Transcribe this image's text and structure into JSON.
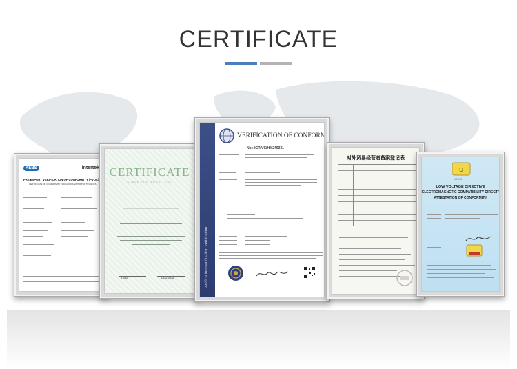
{
  "page": {
    "title": "CERTIFICATE",
    "accent_blue": "#4a7ebd",
    "accent_gray": "#b3b3b3"
  },
  "certificates": [
    {
      "name": "pvoc",
      "heading": "PRE EXPORT VERIFICATION OF CONFORMITY (PVOC)",
      "subheading": "CERTIFICATE OF CONFORMITY FOR GOODS EXPORTED TO KENYA",
      "logo_left": "KEBS",
      "logo_right": "intertek"
    },
    {
      "name": "certificate",
      "heading": "CERTIFICATE",
      "subheading": "SCALE FOR YOUR TEXT",
      "signature_left": "Date",
      "signature_right": "President"
    },
    {
      "name": "verification",
      "heading": "VERIFICATION OF CONFORMITY",
      "number": "No.: ICR/VC/HM240331",
      "side_text": "verification verification verification"
    },
    {
      "name": "foreign-trade",
      "heading": "对外贸易经营者备案登记表"
    },
    {
      "name": "lvd-emc",
      "heading_lines": [
        "LOW VOLTAGE DIRECTIVE",
        "ELECTROMAGNETIC COMPATIBILITY DIRECTIVE",
        "ATTESTATION OF CONFORMITY"
      ],
      "logo": "UDEM"
    }
  ]
}
